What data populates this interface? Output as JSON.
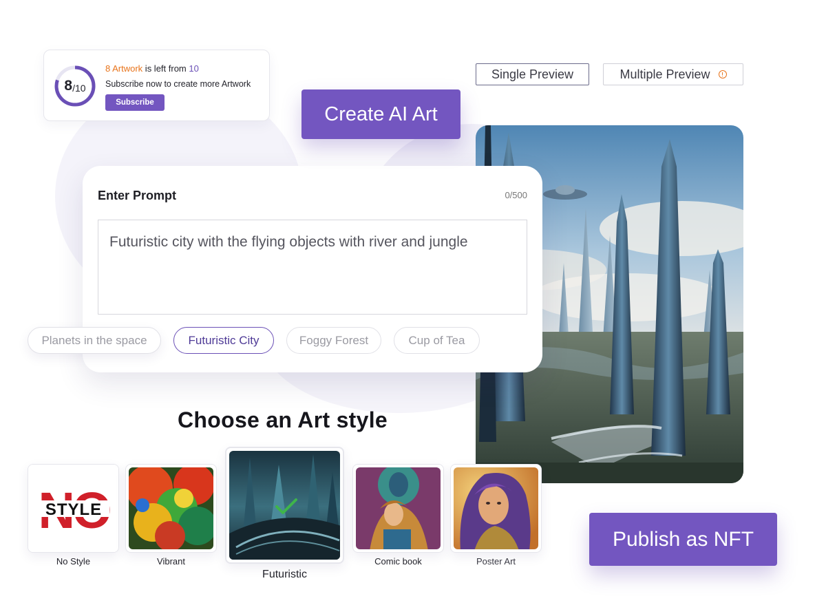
{
  "counter": {
    "remaining": "8",
    "total": "10",
    "ring_denominator": "/10",
    "progress": 0.8,
    "line_prefix": "8 Artwork",
    "line_middle": " is left from ",
    "line_total": "10",
    "subscribe_text": "Subscribe now to create more Artwork",
    "subscribe_button": "Subscribe"
  },
  "preview_toggle": {
    "single": "Single Preview",
    "multiple": "Multiple Preview",
    "multiple_icon": "info-icon"
  },
  "create_button": "Create AI Art",
  "prompt": {
    "title": "Enter Prompt",
    "char_count": "0/500",
    "value": "Futuristic city with the flying objects with river and jungle"
  },
  "suggestions": [
    {
      "label": "Planets in the space",
      "selected": false
    },
    {
      "label": "Futuristic City",
      "selected": true
    },
    {
      "label": "Foggy Forest",
      "selected": false
    },
    {
      "label": "Cup of Tea",
      "selected": false
    }
  ],
  "art_style": {
    "heading": "Choose an Art style",
    "styles": [
      {
        "label": "No Style",
        "selected": false,
        "logo_text": [
          "NO",
          "STYLE"
        ]
      },
      {
        "label": "Vibrant",
        "selected": false
      },
      {
        "label": "Futuristic",
        "selected": true,
        "icon": "checkmark-icon"
      },
      {
        "label": "Comic book",
        "selected": false
      },
      {
        "label": "Poster Art",
        "selected": false
      }
    ]
  },
  "publish_button": "Publish as NFT",
  "colors": {
    "accent": "#7356c0",
    "highlight_orange": "#e8731a",
    "selected_check": "#3fb54a"
  }
}
